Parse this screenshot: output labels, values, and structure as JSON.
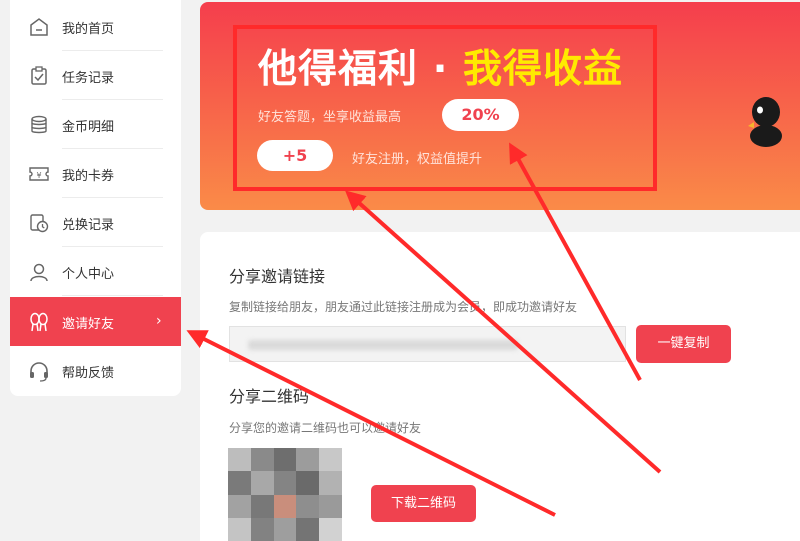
{
  "sidebar": {
    "items": [
      {
        "label": "我的首页",
        "icon": "home-icon"
      },
      {
        "label": "任务记录",
        "icon": "task-clipboard-icon"
      },
      {
        "label": "金币明细",
        "icon": "coins-icon"
      },
      {
        "label": "我的卡券",
        "icon": "coupon-icon"
      },
      {
        "label": "兑换记录",
        "icon": "exchange-history-icon"
      },
      {
        "label": "个人中心",
        "icon": "user-icon"
      },
      {
        "label": "邀请好友",
        "icon": "invite-friends-icon",
        "active": true,
        "chevron": "›"
      },
      {
        "label": "帮助反馈",
        "icon": "headset-icon"
      }
    ]
  },
  "banner": {
    "headline_white": "他得福利 · ",
    "headline_yellow": "我得收益",
    "line1_text": "好友答题，坐享收益最高",
    "line1_badge": "20%",
    "line2_badge": "+5",
    "line2_text": "好友注册，权益值提升"
  },
  "share_link": {
    "title": "分享邀请链接",
    "description": "复制链接给朋友，朋友通过此链接注册成为会员，即成功邀请好友",
    "copy_button": "一键复制"
  },
  "share_qr": {
    "title": "分享二维码",
    "description": "分享您的邀请二维码也可以邀请好友",
    "download_button": "下载二维码"
  },
  "colors": {
    "accent": "#f0424f",
    "banner_top": "#f53e4d",
    "banner_bottom": "#fa8b48",
    "highlight_yellow": "#ffea00",
    "annotation_red": "#ff2a2a"
  }
}
